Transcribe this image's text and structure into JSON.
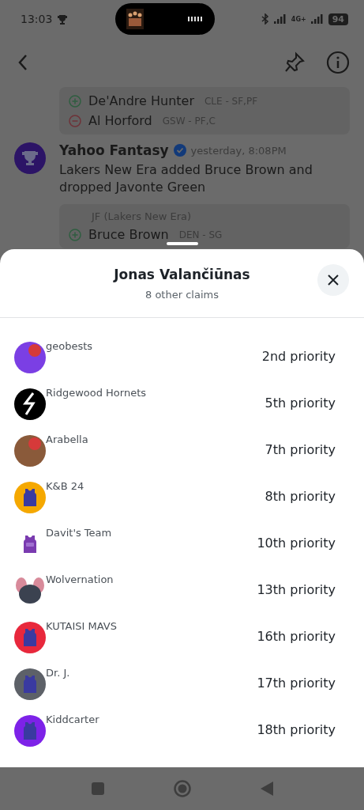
{
  "status_bar": {
    "time": "13:03",
    "network": "4G+",
    "battery": "94"
  },
  "chat": {
    "card_1": {
      "moves": [
        {
          "kind": "add",
          "player": "De'Andre Hunter",
          "team": "CLE - SF,PF"
        },
        {
          "kind": "drop",
          "player": "Al Horford",
          "team": "GSW - PF,C"
        }
      ]
    },
    "message": {
      "sender": "Yahoo Fantasy",
      "verified": true,
      "time": "yesterday, 8:08PM",
      "text": "Lakers New Era added Bruce Brown and dropped Javonte Green"
    },
    "card_2": {
      "owner": "JF (Lakers New Era)",
      "moves": [
        {
          "kind": "add",
          "player": "Bruce Brown",
          "team": "DEN - SG"
        }
      ]
    }
  },
  "sheet": {
    "title": "Jonas Valančiūnas",
    "subtitle": "8 other claims",
    "claims": [
      {
        "team": "geobests",
        "priority": "2nd priority",
        "kind": "photo",
        "color": "#7b3fe4"
      },
      {
        "team": "Ridgewood Hornets",
        "priority": "5th priority",
        "kind": "logo",
        "color": "#000000"
      },
      {
        "team": "Arabella",
        "priority": "7th priority",
        "kind": "photo",
        "color": "#8a5a3a"
      },
      {
        "team": "K&B 24",
        "priority": "8th priority",
        "kind": "jersey",
        "color": "#f5a800"
      },
      {
        "team": "Davit's Team",
        "priority": "10th priority",
        "kind": "bare",
        "color": "#7a3bb0"
      },
      {
        "team": "Wolvernation",
        "priority": "13th priority",
        "kind": "mascot",
        "color": "#3b4250"
      },
      {
        "team": "KUTAISI MAVS",
        "priority": "16th priority",
        "kind": "jersey",
        "color": "#e8283c"
      },
      {
        "team": "Dr. J.",
        "priority": "17th priority",
        "kind": "jersey",
        "color": "#5d6168"
      },
      {
        "team": "Kiddcarter",
        "priority": "18th priority",
        "kind": "jersey",
        "color": "#7d22e8"
      }
    ]
  }
}
